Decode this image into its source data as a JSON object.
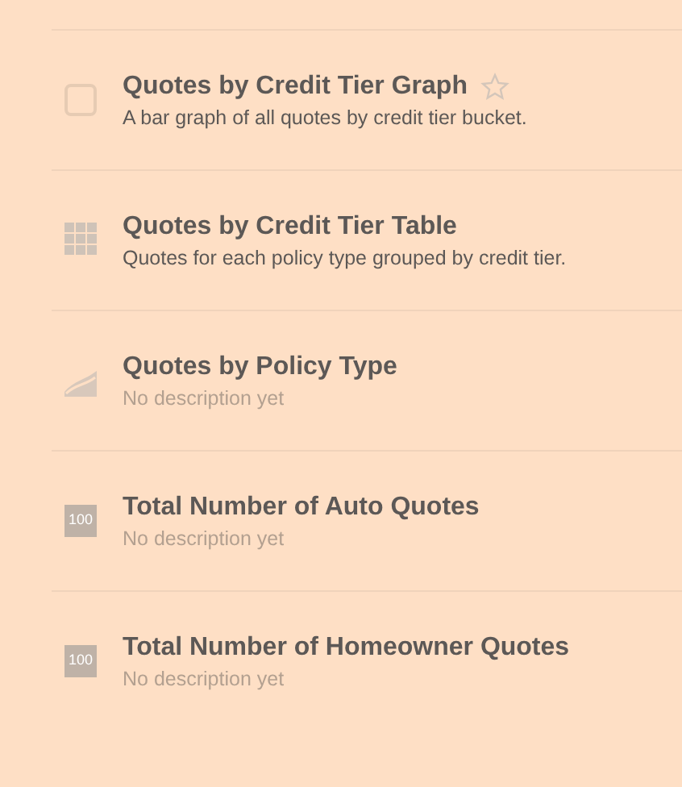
{
  "items": [
    {
      "kind": "checkbox",
      "checked": false,
      "title": "Quotes by Credit Tier Graph",
      "favorite": false,
      "description": "A bar graph of all quotes by credit tier bucket.",
      "description_empty": false
    },
    {
      "kind": "table",
      "title": "Quotes by Credit Tier Table",
      "description": "Quotes for each policy type grouped by credit tier.",
      "description_empty": false
    },
    {
      "kind": "line",
      "title": "Quotes by Policy Type",
      "description": "No description yet",
      "description_empty": true
    },
    {
      "kind": "number",
      "icon_label": "100",
      "title": "Total Number of Auto Quotes",
      "description": "No description yet",
      "description_empty": true
    },
    {
      "kind": "number",
      "icon_label": "100",
      "title": "Total Number of Homeowner Quotes",
      "description": "No description yet",
      "description_empty": true
    }
  ]
}
